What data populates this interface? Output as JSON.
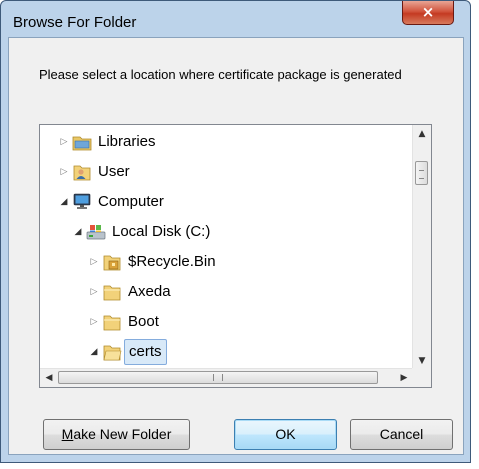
{
  "window": {
    "title": "Browse For Folder",
    "close_glyph": "×"
  },
  "prompt": "Please select a location where certificate package is generated",
  "tree": [
    {
      "label": "Libraries",
      "icon": "libraries-icon",
      "expander": "collapsed",
      "level": 0
    },
    {
      "label": "User",
      "icon": "user-folder-icon",
      "expander": "collapsed",
      "level": 0
    },
    {
      "label": "Computer",
      "icon": "computer-icon",
      "expander": "expanded",
      "level": 0
    },
    {
      "label": "Local Disk (C:)",
      "icon": "local-disk-icon",
      "expander": "expanded",
      "level": 1
    },
    {
      "label": "$Recycle.Bin",
      "icon": "recycle-bin-icon",
      "expander": "collapsed",
      "level": 2
    },
    {
      "label": "Axeda",
      "icon": "folder-icon",
      "expander": "collapsed",
      "level": 2
    },
    {
      "label": "Boot",
      "icon": "folder-icon",
      "expander": "collapsed",
      "level": 2
    },
    {
      "label": "certs",
      "icon": "folder-open-icon",
      "expander": "expanded",
      "level": 2,
      "selected": true
    }
  ],
  "buttons": {
    "make_new_folder_mnemonic": "M",
    "make_new_folder_rest": "ake New Folder",
    "ok": "OK",
    "cancel": "Cancel"
  },
  "colors": {
    "selection_fill": "#d8e9f8",
    "selection_border": "#84acdd",
    "folder_yellow": "#f2d27a",
    "close_red": "#c43a22"
  }
}
